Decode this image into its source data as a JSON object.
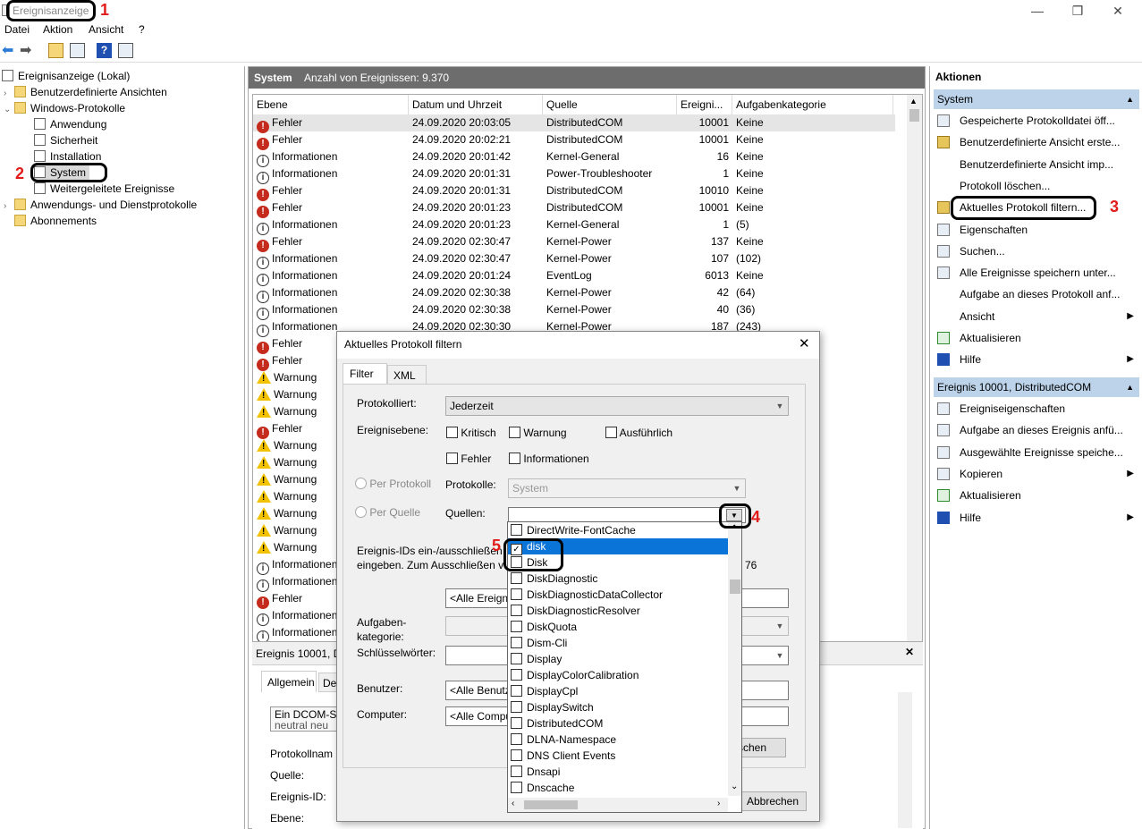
{
  "app": {
    "title": "Ereignisanzeige"
  },
  "window_controls": {
    "minimize": "—",
    "maximize": "❐",
    "close": "✕"
  },
  "menu": {
    "items": [
      "Datei",
      "Aktion",
      "Ansicht",
      "?"
    ]
  },
  "tree": {
    "root": "Ereignisanzeige (Lokal)",
    "custom_views": "Benutzerdefinierte Ansichten",
    "windows_logs": "Windows-Protokolle",
    "children": [
      "Anwendung",
      "Sicherheit",
      "Installation",
      "System",
      "Weitergeleitete Ereignisse"
    ],
    "app_logs": "Anwendungs- und Dienstprotokolle",
    "subscriptions": "Abonnements"
  },
  "center": {
    "title": "System",
    "count_label": "Anzahl von Ereignissen: 9.370",
    "columns": [
      "Ebene",
      "Datum und Uhrzeit",
      "Quelle",
      "Ereigni...",
      "Aufgabenkategorie"
    ],
    "rows": [
      {
        "level": "Fehler",
        "type": "err",
        "date": "24.09.2020 20:03:05",
        "source": "DistributedCOM",
        "id": "10001",
        "cat": "Keine"
      },
      {
        "level": "Fehler",
        "type": "err",
        "date": "24.09.2020 20:02:21",
        "source": "DistributedCOM",
        "id": "10001",
        "cat": "Keine"
      },
      {
        "level": "Informationen",
        "type": "info",
        "date": "24.09.2020 20:01:42",
        "source": "Kernel-General",
        "id": "16",
        "cat": "Keine"
      },
      {
        "level": "Informationen",
        "type": "info",
        "date": "24.09.2020 20:01:31",
        "source": "Power-Troubleshooter",
        "id": "1",
        "cat": "Keine"
      },
      {
        "level": "Fehler",
        "type": "err",
        "date": "24.09.2020 20:01:31",
        "source": "DistributedCOM",
        "id": "10010",
        "cat": "Keine"
      },
      {
        "level": "Fehler",
        "type": "err",
        "date": "24.09.2020 20:01:23",
        "source": "DistributedCOM",
        "id": "10001",
        "cat": "Keine"
      },
      {
        "level": "Informationen",
        "type": "info",
        "date": "24.09.2020 20:01:23",
        "source": "Kernel-General",
        "id": "1",
        "cat": "(5)"
      },
      {
        "level": "Fehler",
        "type": "err",
        "date": "24.09.2020 02:30:47",
        "source": "Kernel-Power",
        "id": "137",
        "cat": "Keine"
      },
      {
        "level": "Informationen",
        "type": "info",
        "date": "24.09.2020 02:30:47",
        "source": "Kernel-Power",
        "id": "107",
        "cat": "(102)"
      },
      {
        "level": "Informationen",
        "type": "info",
        "date": "24.09.2020 20:01:24",
        "source": "EventLog",
        "id": "6013",
        "cat": "Keine"
      },
      {
        "level": "Informationen",
        "type": "info",
        "date": "24.09.2020 02:30:38",
        "source": "Kernel-Power",
        "id": "42",
        "cat": "(64)"
      },
      {
        "level": "Informationen",
        "type": "info",
        "date": "24.09.2020 02:30:38",
        "source": "Kernel-Power",
        "id": "40",
        "cat": "(36)"
      },
      {
        "level": "Informationen",
        "type": "info",
        "date": "24.09.2020 02:30:30",
        "source": "Kernel-Power",
        "id": "187",
        "cat": "(243)"
      },
      {
        "level": "Fehler",
        "type": "err",
        "date": "",
        "source": "",
        "id": "",
        "cat": ""
      },
      {
        "level": "Fehler",
        "type": "err",
        "date": "",
        "source": "",
        "id": "",
        "cat": ""
      },
      {
        "level": "Warnung",
        "type": "warn",
        "date": "",
        "source": "",
        "id": "",
        "cat": ""
      },
      {
        "level": "Warnung",
        "type": "warn",
        "date": "",
        "source": "",
        "id": "",
        "cat": ""
      },
      {
        "level": "Warnung",
        "type": "warn",
        "date": "",
        "source": "",
        "id": "",
        "cat": ""
      },
      {
        "level": "Fehler",
        "type": "err",
        "date": "",
        "source": "",
        "id": "",
        "cat": ""
      },
      {
        "level": "Warnung",
        "type": "warn",
        "date": "",
        "source": "",
        "id": "",
        "cat": ""
      },
      {
        "level": "Warnung",
        "type": "warn",
        "date": "",
        "source": "",
        "id": "",
        "cat": ""
      },
      {
        "level": "Warnung",
        "type": "warn",
        "date": "",
        "source": "",
        "id": "",
        "cat": ""
      },
      {
        "level": "Warnung",
        "type": "warn",
        "date": "",
        "source": "",
        "id": "",
        "cat": ""
      },
      {
        "level": "Warnung",
        "type": "warn",
        "date": "",
        "source": "",
        "id": "",
        "cat": ""
      },
      {
        "level": "Warnung",
        "type": "warn",
        "date": "",
        "source": "",
        "id": "",
        "cat": ""
      },
      {
        "level": "Warnung",
        "type": "warn",
        "date": "",
        "source": "",
        "id": "",
        "cat": ""
      },
      {
        "level": "Informationen",
        "type": "info",
        "date": "",
        "source": "",
        "id": "",
        "cat": ""
      },
      {
        "level": "Informationen",
        "type": "info",
        "date": "",
        "source": "",
        "id": "",
        "cat": ""
      },
      {
        "level": "Fehler",
        "type": "err",
        "date": "",
        "source": "",
        "id": "",
        "cat": ""
      },
      {
        "level": "Informationen",
        "type": "info",
        "date": "",
        "source": "",
        "id": "",
        "cat": ""
      },
      {
        "level": "Informationen",
        "type": "info",
        "date": "",
        "source": "",
        "id": "",
        "cat": ""
      }
    ]
  },
  "detail": {
    "title": "Ereignis 10001, D",
    "tab_general": "Allgemein",
    "tab_details": "De",
    "message": "Ein DCOM-Se",
    "message_line2": "neutral neu",
    "labels": [
      "Protokollnam",
      "Quelle:",
      "Ereignis-ID:",
      "Ebene:"
    ]
  },
  "actions": {
    "header": "Aktionen",
    "section1": "System",
    "items1": [
      {
        "label": "Gespeicherte Protokolldatei öff...",
        "icon": "open-log-icon",
        "arrow": false
      },
      {
        "label": "Benutzerdefinierte Ansicht erste...",
        "icon": "filter-create-icon",
        "arrow": false
      },
      {
        "label": "Benutzerdefinierte Ansicht imp...",
        "icon": "",
        "arrow": false
      },
      {
        "label": "Protokoll löschen...",
        "icon": "",
        "arrow": false
      },
      {
        "label": "Aktuelles Protokoll filtern...",
        "icon": "filter-icon",
        "arrow": false
      },
      {
        "label": "Eigenschaften",
        "icon": "properties-icon",
        "arrow": false
      },
      {
        "label": "Suchen...",
        "icon": "find-icon",
        "arrow": false
      },
      {
        "label": "Alle Ereignisse speichern unter...",
        "icon": "save-icon",
        "arrow": false
      },
      {
        "label": "Aufgabe an dieses Protokoll anf...",
        "icon": "",
        "arrow": false
      },
      {
        "label": "Ansicht",
        "icon": "",
        "arrow": true
      },
      {
        "label": "Aktualisieren",
        "icon": "refresh-icon",
        "arrow": false
      },
      {
        "label": "Hilfe",
        "icon": "help-icon",
        "arrow": true
      }
    ],
    "section2": "Ereignis 10001, DistributedCOM",
    "items2": [
      {
        "label": "Ereigniseigenschaften",
        "icon": "event-properties-icon",
        "arrow": false
      },
      {
        "label": "Aufgabe an dieses Ereignis anfü...",
        "icon": "task-icon",
        "arrow": false
      },
      {
        "label": "Ausgewählte Ereignisse speiche...",
        "icon": "save-icon",
        "arrow": false
      },
      {
        "label": "Kopieren",
        "icon": "copy-icon",
        "arrow": true
      },
      {
        "label": "Aktualisieren",
        "icon": "refresh-icon",
        "arrow": false
      },
      {
        "label": "Hilfe",
        "icon": "help-icon",
        "arrow": true
      }
    ]
  },
  "dialog": {
    "title": "Aktuelles Protokoll filtern",
    "tab_filter": "Filter",
    "tab_xml": "XML",
    "logged_label": "Protokolliert:",
    "logged_value": "Jederzeit",
    "level_label": "Ereignisebene:",
    "levels": {
      "critical": "Kritisch",
      "warning": "Warnung",
      "verbose": "Ausführlich",
      "error": "Fehler",
      "info": "Informationen"
    },
    "per_log": "Per Protokoll",
    "per_source": "Per Quelle",
    "logs_label": "Protokolle:",
    "logs_value": "System",
    "sources_label": "Quellen:",
    "ids_text1": "Ereignis-IDs ein-/ausschließen",
    "ids_text2": "eingeben. Zum Ausschließen v",
    "ids_tail": "76",
    "ids_value": "<Alle Ereigni",
    "task_label": "Aufgaben-",
    "task_label2": "kategorie:",
    "keywords_label": "Schlüsselwörter:",
    "user_label": "Benutzer:",
    "user_value": "<Alle Benutz",
    "computer_label": "Computer:",
    "computer_value": "<Alle Compu",
    "clear_button": "schen",
    "cancel_button": "Abbrechen"
  },
  "dropdown": {
    "items": [
      {
        "label": "DirectWrite-FontCache",
        "checked": false,
        "selected": false
      },
      {
        "label": "disk",
        "checked": true,
        "selected": true
      },
      {
        "label": "Disk",
        "checked": false,
        "selected": false
      },
      {
        "label": "DiskDiagnostic",
        "checked": false,
        "selected": false
      },
      {
        "label": "DiskDiagnosticDataCollector",
        "checked": false,
        "selected": false
      },
      {
        "label": "DiskDiagnosticResolver",
        "checked": false,
        "selected": false
      },
      {
        "label": "DiskQuota",
        "checked": false,
        "selected": false
      },
      {
        "label": "Dism-Cli",
        "checked": false,
        "selected": false
      },
      {
        "label": "Display",
        "checked": false,
        "selected": false
      },
      {
        "label": "DisplayColorCalibration",
        "checked": false,
        "selected": false
      },
      {
        "label": "DisplayCpl",
        "checked": false,
        "selected": false
      },
      {
        "label": "DisplaySwitch",
        "checked": false,
        "selected": false
      },
      {
        "label": "DistributedCOM",
        "checked": false,
        "selected": false
      },
      {
        "label": "DLNA-Namespace",
        "checked": false,
        "selected": false
      },
      {
        "label": "DNS Client Events",
        "checked": false,
        "selected": false
      },
      {
        "label": "Dnsapi",
        "checked": false,
        "selected": false
      },
      {
        "label": "Dnscache",
        "checked": false,
        "selected": false
      }
    ]
  },
  "annotations": [
    "1",
    "2",
    "3",
    "4",
    "5"
  ],
  "colors": {
    "accent": "#0a74d8",
    "section": "#bcd3ea",
    "header": "#6d6d6d",
    "annotation": "#e21b1b"
  }
}
